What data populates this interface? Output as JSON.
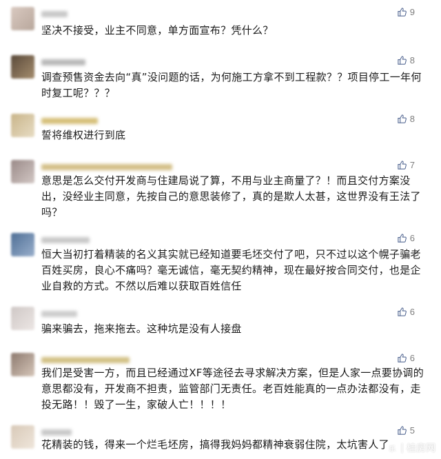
{
  "comments": [
    {
      "text": "坚决不接受，业主不同意，单方面宣布？凭什么？",
      "likes": "9",
      "avatar_colors": [
        "#d9c9c0",
        "#b8a79c"
      ],
      "name_color": "#c8c8c8",
      "name_width": 38
    },
    {
      "text": "调查预售资金去向“真”没问题的话，为何施工方拿不到工程款？？项目停工一年何时复工呢？？？",
      "likes": "8",
      "avatar_colors": [
        "#5a4a3a",
        "#a48c6d"
      ],
      "name_color": "#b9b9b9",
      "name_width": 64
    },
    {
      "text": "誓将维权进行到底",
      "likes": "8",
      "avatar_colors": [
        "#c9b58a",
        "#e7dcc3"
      ],
      "name_color": "#d6c07a",
      "name_width": 82
    },
    {
      "text": "意思是怎么交付开发商与住建局说了算，不用与业主商量了？！而且交付方案没出，没经业主同意，先按自己的意思装修了，真的是欺人太甚，这世界没有王法了吗？",
      "likes": "7",
      "avatar_colors": [
        "#9a8a88",
        "#d2c7c4"
      ],
      "name_color": "#d4c089",
      "name_width": 190
    },
    {
      "text": "恒大当初打着精装的名义其实就已经知道要毛坯交付了吧，只不过以这个幌子骗老百姓买房，良心不痛吗？毫无诚信，毫无契约精神，现在最好按合同交付，也是企业自救的方式。不然以后难以获取百姓信任",
      "likes": "6",
      "avatar_colors": [
        "#4f6f96",
        "#98aecb"
      ],
      "name_color": "#c9c9c9",
      "name_width": 70
    },
    {
      "text": "骗来骗去，拖来拖去。这种坑是没有人接盘",
      "likes": "6",
      "avatar_colors": [
        "#cfc8c6",
        "#ece6e4"
      ],
      "name_color": "#cdcdcd",
      "name_width": 52
    },
    {
      "text": "我们是受害一方，而且已经通过XF等途径去寻求解决方案，但是人家一点要协调的意思都没有，开发商不担责，监管部门无责任。老百姓能真的一点办法都没有，走投无路！！毁了一生，家破人亡！！！！",
      "likes": "6",
      "avatar_colors": [
        "#8d7a6f",
        "#d5c5b8"
      ],
      "name_color": "#d3c186",
      "name_width": 128
    },
    {
      "text": "花精装的钱，得来一个烂毛坯房，搞得我妈妈都精神衰弱住院，太坑害人了",
      "likes": "5",
      "avatar_colors": [
        "#d8c9b8",
        "#efe6db"
      ],
      "name_color": "#c9c9c9",
      "name_width": 44
    }
  ],
  "watermark": {
    "text": "桂房网",
    "badge": "乐"
  }
}
